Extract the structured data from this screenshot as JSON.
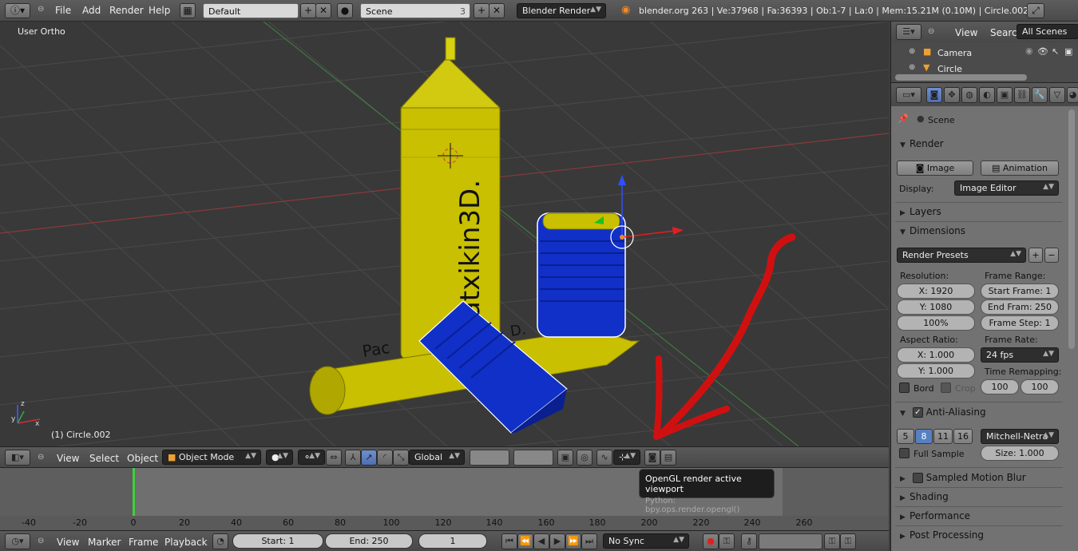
{
  "topbar": {
    "menus": [
      "File",
      "Add",
      "Render",
      "Help"
    ],
    "layout": "Default",
    "scene": "Scene",
    "scene_users": "3",
    "engine": "Blender Render",
    "stats": "blender.org 263 | Ve:37968 | Fa:36393 | Ob:1-7 | La:0 | Mem:15.21M (0.10M) | Circle.002"
  },
  "viewport": {
    "view_name": "User Ortho",
    "object_label": "(1) Circle.002",
    "bottle_text": "Patxikin3D.",
    "bottle_text_2": "Pac",
    "bottle_text_3": "D."
  },
  "vp_header": {
    "menus": [
      "View",
      "Select",
      "Object"
    ],
    "mode": "Object Mode",
    "orientation": "Global"
  },
  "tooltip": {
    "title": "OpenGL render active viewport",
    "python": "Python: bpy.ops.render.opengl()"
  },
  "timeline": {
    "ticks": [
      "-40",
      "-20",
      "0",
      "20",
      "40",
      "60",
      "80",
      "100",
      "120",
      "140",
      "160",
      "180",
      "200",
      "220",
      "240",
      "260"
    ],
    "menus": [
      "View",
      "Marker",
      "Frame",
      "Playback"
    ],
    "start": "Start: 1",
    "end": "End: 250",
    "current": "1",
    "sync": "No Sync"
  },
  "outliner": {
    "menus": [
      "View",
      "Search"
    ],
    "filter": "All Scenes",
    "items": [
      "Camera",
      "Circle"
    ]
  },
  "properties": {
    "context": "Scene",
    "render": {
      "title": "Render",
      "image_btn": "Image",
      "animation_btn": "Animation",
      "display_label": "Display:",
      "display_value": "Image Editor"
    },
    "layers_title": "Layers",
    "dimensions": {
      "title": "Dimensions",
      "presets": "Render Presets",
      "resolution_label": "Resolution:",
      "res_x": "X: 1920",
      "res_y": "Y: 1080",
      "res_pct": "100%",
      "frame_range_label": "Frame Range:",
      "start_frame": "Start Frame: 1",
      "end_frame": "End Fram: 250",
      "frame_step": "Frame Step: 1",
      "aspect_label": "Aspect Ratio:",
      "aspect_x": "X: 1.000",
      "aspect_y": "Y: 1.000",
      "frame_rate_label": "Frame Rate:",
      "fps": "24 fps",
      "remap_label": "Time Remapping:",
      "remap_old": "100",
      "remap_new": "100",
      "bord": "Bord",
      "crop": "Crop"
    },
    "aa": {
      "title": "Anti-Aliasing",
      "samples": [
        "5",
        "8",
        "11",
        "16"
      ],
      "filter": "Mitchell-Netra",
      "full_sample": "Full Sample",
      "size": "Size: 1.000"
    },
    "motion_blur": "Sampled Motion Blur",
    "shading": "Shading",
    "performance": "Performance",
    "post_processing": "Post Processing"
  },
  "colors": {
    "accent": "#5680c2",
    "yellow": "#c8c000",
    "blue": "#1030c8",
    "red_arrow": "#d01010"
  }
}
